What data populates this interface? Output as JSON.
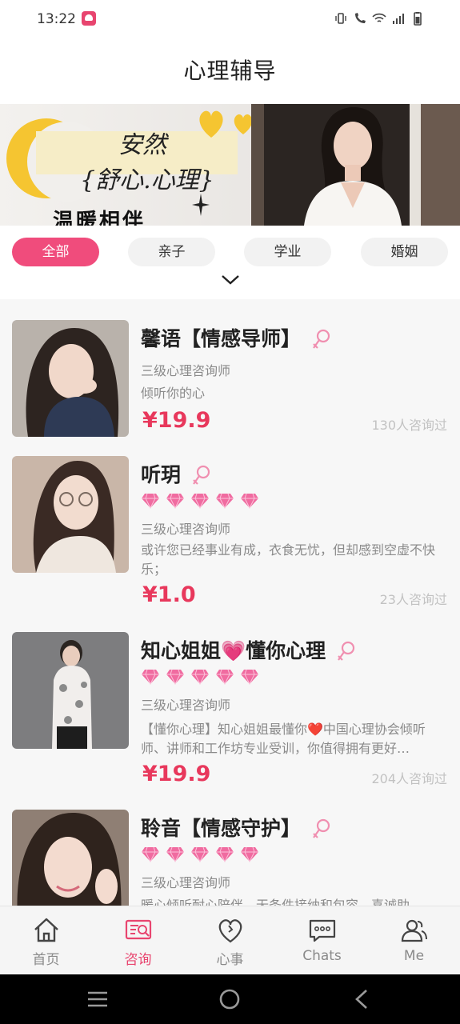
{
  "status_bar": {
    "time": "13:22",
    "icons": [
      "app-icon",
      "vibrate-icon",
      "wifi-call-icon",
      "wifi-icon",
      "signal-icon",
      "battery-icon"
    ]
  },
  "header": {
    "title": "心理辅导"
  },
  "banner": {
    "line1": "安然",
    "line2": "{舒心.心理}",
    "line3": "温暖相伴"
  },
  "tabs": [
    {
      "label": "全部",
      "active": true
    },
    {
      "label": "亲子",
      "active": false
    },
    {
      "label": "学业",
      "active": false
    },
    {
      "label": "婚姻",
      "active": false
    }
  ],
  "counselors": [
    {
      "name": "馨语【情感导师】",
      "gems": 0,
      "level": "三级心理咨询师",
      "desc": "倾听你的心",
      "price": "¥19.9",
      "count": "130人咨询过"
    },
    {
      "name": "听玥",
      "gems": 5,
      "level": "三级心理咨询师",
      "desc": "或许您已经事业有成，衣食无忧，但却感到空虚不快乐；",
      "price": "¥1.0",
      "count": "23人咨询过"
    },
    {
      "name": "知心姐姐💗懂你心理",
      "gems": 5,
      "level": "三级心理咨询师",
      "desc": "【懂你心理】知心姐姐最懂你❤️中国心理协会倾听师、讲师和工作坊专业受训，你值得拥有更好…",
      "price": "¥19.9",
      "count": "204人咨询过"
    },
    {
      "name": "聆音【情感守护】",
      "gems": 5,
      "level": "三级心理咨询师",
      "desc": "暖心倾听耐心陪伴，无条件接纳和包容，喜诚助",
      "price": "",
      "count": ""
    }
  ],
  "bottom_nav": [
    {
      "label": "首页",
      "icon": "home-icon",
      "active": false
    },
    {
      "label": "咨询",
      "icon": "consult-icon",
      "active": true
    },
    {
      "label": "心事",
      "icon": "heart-icon",
      "active": false
    },
    {
      "label": "Chats",
      "icon": "chat-icon",
      "active": false
    },
    {
      "label": "Me",
      "icon": "user-icon",
      "active": false
    }
  ],
  "colors": {
    "accent": "#f04c7c",
    "price": "#e8385c",
    "gem": "#f06ba0"
  }
}
